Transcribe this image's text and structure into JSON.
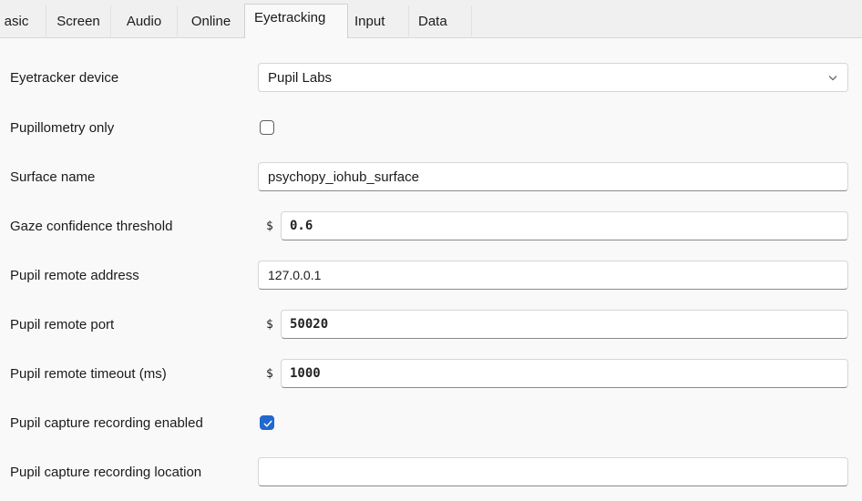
{
  "tabs": [
    {
      "label": "asic"
    },
    {
      "label": "Screen"
    },
    {
      "label": "Audio"
    },
    {
      "label": "Online"
    },
    {
      "label": "Eyetracking"
    },
    {
      "label": "Input"
    },
    {
      "label": "Data"
    }
  ],
  "active_tab": "Eyetracking",
  "form": {
    "eyetracker_device": {
      "label": "Eyetracker device",
      "value": "Pupil Labs"
    },
    "pupillometry_only": {
      "label": "Pupillometry only",
      "checked": false
    },
    "surface_name": {
      "label": "Surface name",
      "value": "psychopy_iohub_surface"
    },
    "gaze_confidence_threshold": {
      "label": "Gaze confidence threshold",
      "prefix": "$",
      "value": "0.6"
    },
    "pupil_remote_address": {
      "label": "Pupil remote address",
      "value": "127.0.0.1"
    },
    "pupil_remote_port": {
      "label": "Pupil remote port",
      "prefix": "$",
      "value": "50020"
    },
    "pupil_remote_timeout": {
      "label": "Pupil remote timeout (ms)",
      "prefix": "$",
      "value": "1000"
    },
    "pupil_capture_recording_enabled": {
      "label": "Pupil capture recording enabled",
      "checked": true
    },
    "pupil_capture_recording_location": {
      "label": "Pupil capture recording location",
      "value": ""
    }
  },
  "colors": {
    "accent": "#2168cf",
    "background": "#f9f9f9",
    "tabbar": "#f0f0f0"
  },
  "icons": {
    "dropdown": "chevron-down-icon",
    "check": "checkmark-icon"
  }
}
